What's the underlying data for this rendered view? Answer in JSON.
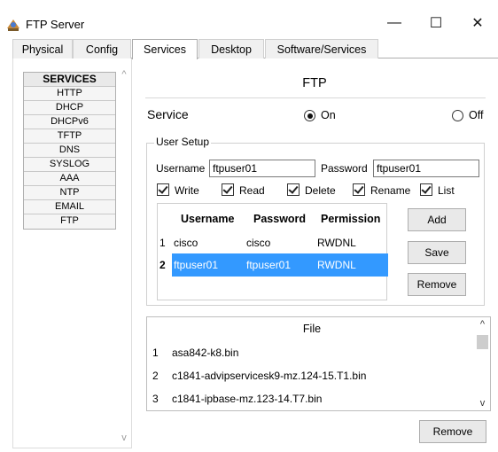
{
  "window": {
    "title": "FTP Server",
    "controls": {
      "minimize": "—",
      "maximize": "☐",
      "close": "✕"
    }
  },
  "tabs": [
    {
      "label": "Physical"
    },
    {
      "label": "Config"
    },
    {
      "label": "Services",
      "active": true
    },
    {
      "label": "Desktop"
    },
    {
      "label": "Software/Services"
    }
  ],
  "services": {
    "header": "SERVICES",
    "items": [
      "HTTP",
      "DHCP",
      "DHCPv6",
      "TFTP",
      "DNS",
      "SYSLOG",
      "AAA",
      "NTP",
      "EMAIL",
      "FTP"
    ]
  },
  "ftp": {
    "title": "FTP",
    "service_label": "Service",
    "on_label": "On",
    "off_label": "Off",
    "selected": "On"
  },
  "user_setup": {
    "title": "User Setup",
    "username_label": "Username",
    "username_value": "ftpuser01",
    "password_label": "Password",
    "password_value": "ftpuser01",
    "permissions": [
      {
        "label": "Write",
        "checked": true
      },
      {
        "label": "Read",
        "checked": true
      },
      {
        "label": "Delete",
        "checked": true
      },
      {
        "label": "Rename",
        "checked": true
      },
      {
        "label": "List",
        "checked": true
      }
    ],
    "table": {
      "columns": [
        "Username",
        "Password",
        "Permission"
      ],
      "rows": [
        {
          "num": "1",
          "username": "cisco",
          "password": "cisco",
          "permission": "RWDNL"
        },
        {
          "num": "2",
          "username": "ftpuser01",
          "password": "ftpuser01",
          "permission": "RWDNL",
          "selected": true
        }
      ]
    },
    "buttons": {
      "add": "Add",
      "save": "Save",
      "remove": "Remove"
    }
  },
  "files": {
    "header": "File",
    "rows": [
      {
        "num": "1",
        "name": "asa842-k8.bin"
      },
      {
        "num": "2",
        "name": "c1841-advipservicesk9-mz.124-15.T1.bin"
      },
      {
        "num": "3",
        "name": "c1841-ipbase-mz.123-14.T7.bin"
      }
    ],
    "remove": "Remove"
  },
  "colors": {
    "selection": "#3399ff"
  }
}
